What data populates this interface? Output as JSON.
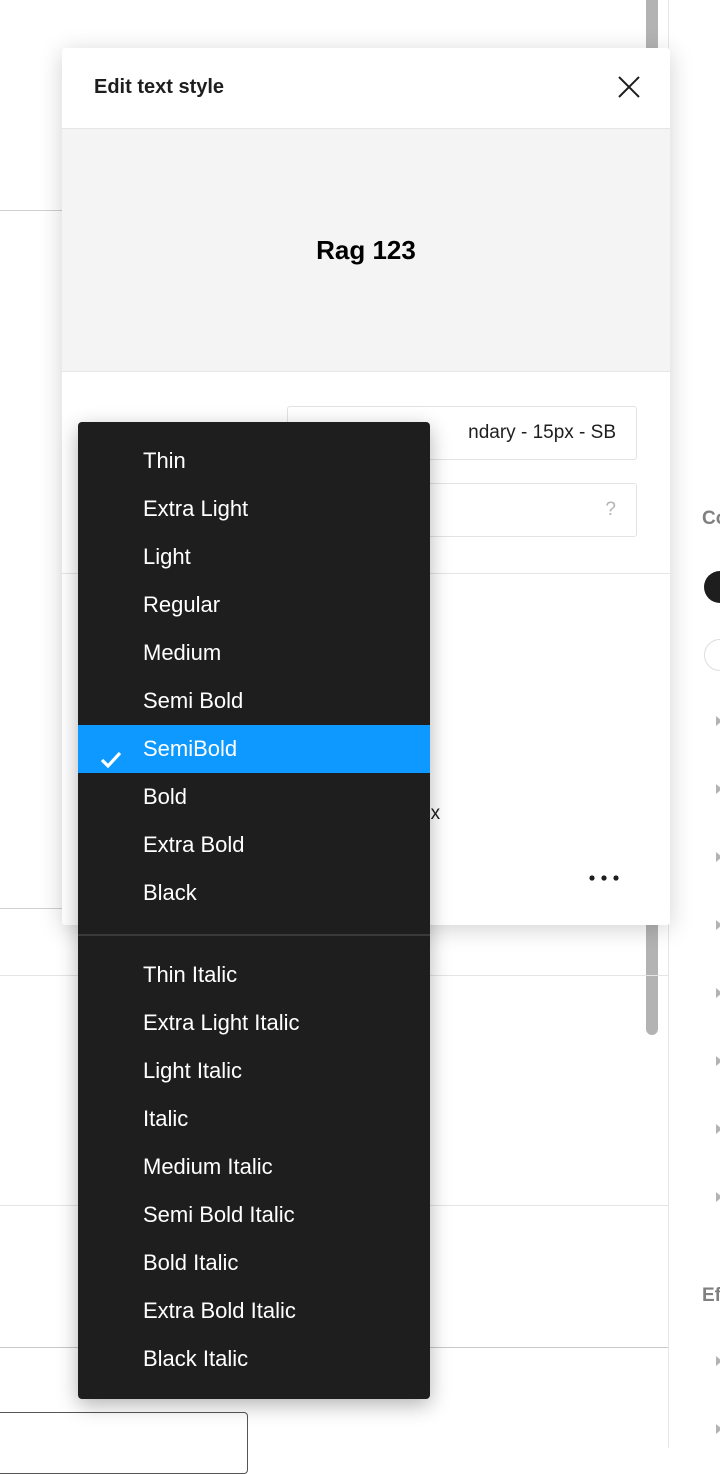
{
  "dialog": {
    "title": "Edit text style",
    "preview_text": "Rag 123",
    "style_name_value": "ndary - 15px - SB",
    "description_placeholder": "?",
    "line_height_partial": "px",
    "more_icon": "ellipsis-icon",
    "close_icon": "close-icon"
  },
  "right_panel": {
    "section_1_label": "Co",
    "section_2_label": "Ef"
  },
  "font_weight_menu": {
    "selected": "SemiBold",
    "accent_color": "#0d99ff",
    "upright": [
      "Thin",
      "Extra Light",
      "Light",
      "Regular",
      "Medium",
      "Semi Bold",
      "SemiBold",
      "Bold",
      "Extra Bold",
      "Black"
    ],
    "italic": [
      "Thin Italic",
      "Extra Light Italic",
      "Light Italic",
      "Italic",
      "Medium Italic",
      "Semi Bold Italic",
      "Bold Italic",
      "Extra Bold Italic",
      "Black Italic"
    ]
  }
}
